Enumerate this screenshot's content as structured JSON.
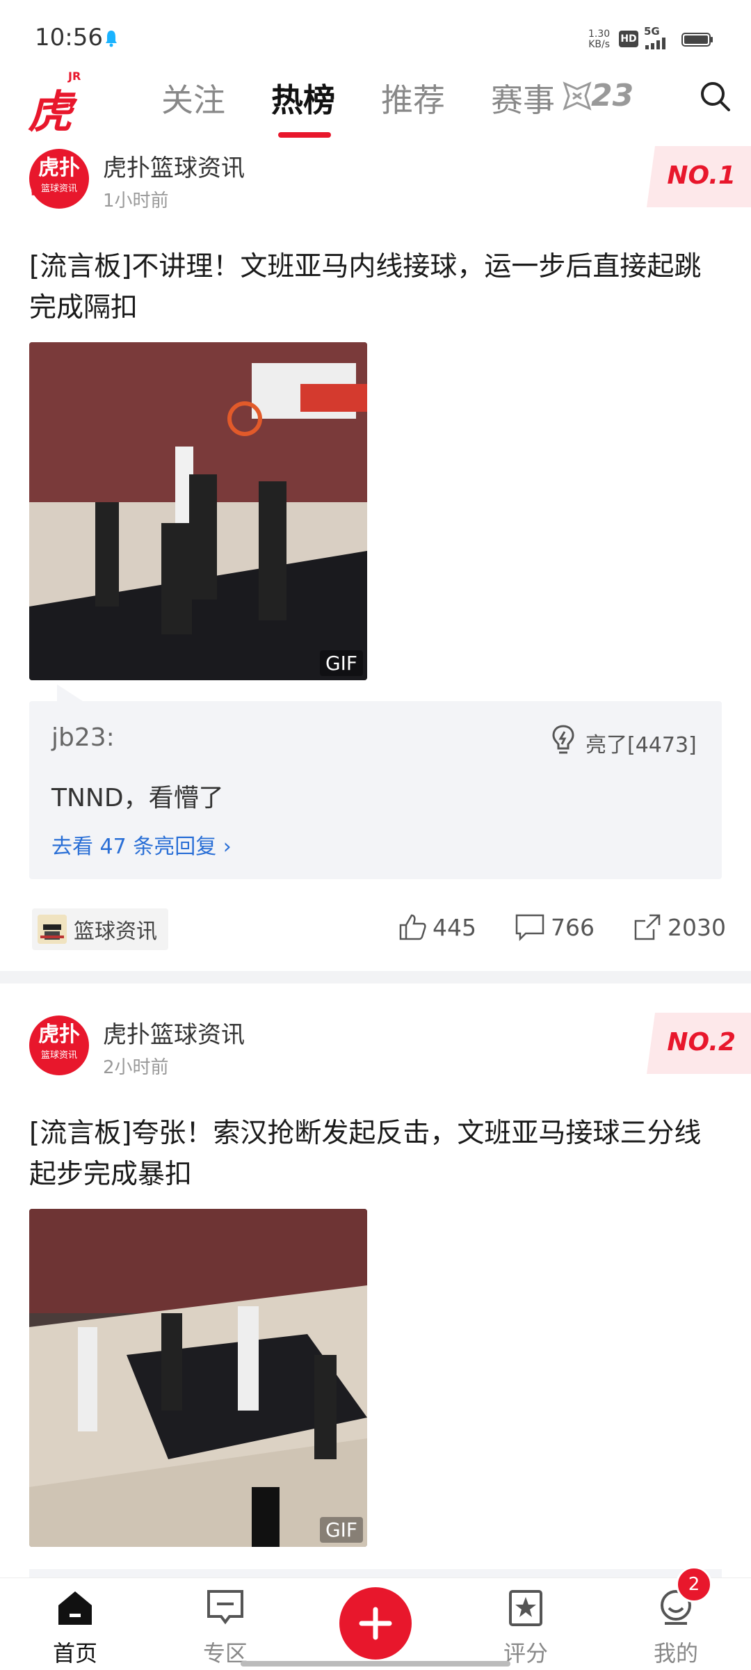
{
  "status_bar": {
    "time": "10:56",
    "net_speed": "1.30",
    "net_unit": "KB/s",
    "hd": "HD",
    "signal": "5G"
  },
  "header": {
    "logo_text": "虎扑",
    "logo_sup": "JR",
    "tabs": [
      {
        "label": "关注",
        "active": false
      },
      {
        "label": "热榜",
        "active": true
      },
      {
        "label": "推荐",
        "active": false
      },
      {
        "label": "赛事",
        "active": false
      }
    ],
    "event_badge": "23"
  },
  "posts": [
    {
      "avatar_line1": "虎扑",
      "avatar_line2": "篮球资讯",
      "author": "虎扑篮球资讯",
      "time": "1小时前",
      "rank": "NO.1",
      "title": "[流言板]不讲理！文班亚马内线接球，运一步后直接起跳完成隔扣",
      "media_tag": "GIF",
      "top_comment": {
        "user": "jb23:",
        "light": "亮了[4473]",
        "text": "TNND，看懵了",
        "more": "去看 47 条亮回复"
      },
      "tag": "篮球资讯",
      "likes": "445",
      "comments": "766",
      "shares": "2030"
    },
    {
      "avatar_line1": "虎扑",
      "avatar_line2": "篮球资讯",
      "author": "虎扑篮球资讯",
      "time": "2小时前",
      "rank": "NO.2",
      "title": "[流言板]夸张！索汉抢断发起反击，文班亚马接球三分线起步完成暴扣",
      "media_tag": "GIF"
    }
  ],
  "bottom_nav": {
    "items": [
      {
        "label": "首页",
        "active": true
      },
      {
        "label": "专区",
        "active": false
      },
      {
        "label": "评分",
        "active": false
      },
      {
        "label": "我的",
        "active": false
      }
    ],
    "badge_count": "2"
  },
  "colors": {
    "accent": "#e8172c",
    "link": "#2a6fd6",
    "comment_bg": "#f3f4f7"
  }
}
